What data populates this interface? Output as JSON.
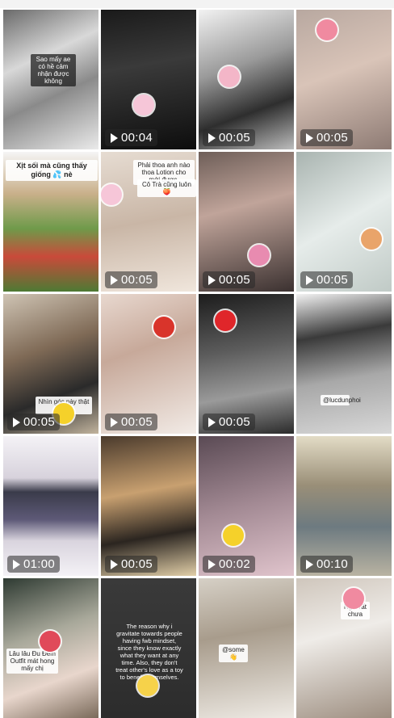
{
  "tiles": [
    {
      "duration": "",
      "bg": "linear-gradient(155deg,#6a6a6a 0%,#d8d8d8 35%,#8a8a8a 60%,#eaeaea 100%)",
      "caption": "Sao mấy ae có hề cảm nhận được không",
      "cap_style": "dark"
    },
    {
      "duration": "00:04",
      "bg": "linear-gradient(170deg,#1a1a1a 0%,#3a3a3a 40%,#0d0d0d 100%)",
      "sticker": "bunny-sticker"
    },
    {
      "duration": "00:05",
      "bg": "linear-gradient(160deg,#f2f2f2 0%,#9a9a9a 40%,#2e2e2e 70%,#bdbdbd 100%)",
      "sticker": "bear-sticker"
    },
    {
      "duration": "00:05",
      "bg": "linear-gradient(160deg,#b8a8a0 0%,#d9c4b8 45%,#8e7b74 100%)",
      "sticker": "pig-sticker"
    },
    {
      "duration": "",
      "bg": "linear-gradient(180deg,#f5f5f5 0%,#c9b08a 30%,#6f9a4a 55%,#c94a3a 75%,#4d7a34 100%)",
      "caption": "Xịt sối mà cũng thấy giống 💦 nè",
      "cap_style": "big"
    },
    {
      "duration": "00:05",
      "bg": "linear-gradient(170deg,#e6dcd2 0%,#c9b6a6 50%,#f0e6dc 100%)",
      "caption": "Phải thoa anh nào thoa Lotion cho mới được.",
      "caption2": "Cô Trà cũng luôn🍑",
      "sticker": "bunny-sticker"
    },
    {
      "duration": "00:05",
      "bg": "linear-gradient(165deg,#6e5e58 0%,#c0a49a 40%,#3b3130 100%)",
      "sticker": "flower-sticker"
    },
    {
      "duration": "00:05",
      "bg": "linear-gradient(150deg,#a9b4b0 0%,#e6ecea 50%,#c0cac6 100%)",
      "sticker": "dog-sticker"
    },
    {
      "duration": "00:05",
      "bg": "linear-gradient(160deg,#cfc4b4 0%,#7f6a56 40%,#2a2a2a 70%,#c2b49e 100%)",
      "caption": "Nhìn góc này thật thích",
      "sticker": "duck-sticker"
    },
    {
      "duration": "00:05",
      "bg": "linear-gradient(160deg,#e8d8cf 0%,#c7a99a 40%,#f2ebe6 100%)",
      "sticker": "cartoon-sticker"
    },
    {
      "duration": "00:05",
      "bg": "linear-gradient(170deg,#1c1c1c 0%,#5c5c5c 40%,#9a9a9a 70%,#2b2b2b 100%)",
      "sticker": "emoji-sticker"
    },
    {
      "duration": "",
      "bg": "linear-gradient(170deg,#f2f2f2 0%,#3a3a3a 30%,#a8a8a8 60%,#d8d8d8 100%)",
      "caption": "@lucdunphoi"
    },
    {
      "duration": "01:00",
      "bg": "linear-gradient(180deg,#f4f2f6 0%,#d7d2dc 30%,#3a3b4a 40%,#5e5a78 60%,#d9d4de 75%,#f4f2f6 100%)"
    },
    {
      "duration": "00:05",
      "bg": "linear-gradient(170deg,#4a3a2c 0%,#c8a070 40%,#2b2520 70%,#e2cfa8 100%)"
    },
    {
      "duration": "00:02",
      "bg": "linear-gradient(165deg,#5a4a54 0%,#a38a94 50%,#e0c4cc 100%)",
      "sticker": "duck-sticker"
    },
    {
      "duration": "00:10",
      "bg": "linear-gradient(180deg,#e3dcc6 0%,#9a8f78 35%,#6d7a80 65%,#b9b3a2 100%)"
    },
    {
      "duration": "",
      "bg": "linear-gradient(160deg,#2e3a32 0%,#a8a89a 40%,#e8d6cc 70%,#7a6a5a 100%)",
      "caption": "Lâu lâu Đu Đêm Outfit mát hong mấy chị",
      "sticker": "heart-sticker"
    },
    {
      "duration": "",
      "bg": "linear-gradient(180deg,#3a3a3a 0%,#2c2c2c 100%)",
      "quote": "The reason why i gravitate towards people having fwb mindset, since they know exactly what they want at any time. Also, they don't treat other's love as a toy to benefit themselves.",
      "sticker": "smile-sticker"
    },
    {
      "duration": "",
      "bg": "linear-gradient(170deg,#d6d0c6 0%,#a89c8c 40%,#eeeae4 100%)",
      "caption": "@some👋"
    },
    {
      "duration": "",
      "bg": "linear-gradient(165deg,#cfc6bc 0%,#efece8 40%,#9d8e80 100%)",
      "caption": "Ngại rất chưa",
      "sticker": "pig-sticker"
    }
  ]
}
